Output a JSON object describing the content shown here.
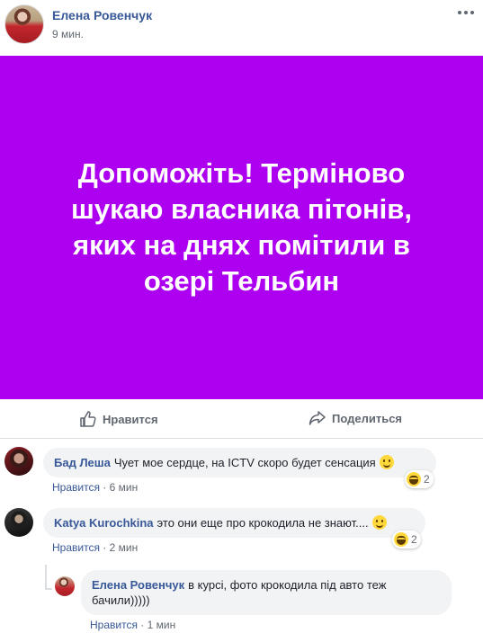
{
  "post": {
    "author": "Елена Ровенчук",
    "time": "9 мин.",
    "text": "Допоможіть! Терміново шукаю власника пітонів, яких на днях помітили в озері Тельбин",
    "background_color": "#ad00f1"
  },
  "actions": {
    "like_label": "Нравится",
    "share_label": "Поделиться"
  },
  "comments": [
    {
      "author": "Бад Леша",
      "text": "Чует мое сердце, на ICTV скоро будет сенсация",
      "emoji": "slightly-smiling-face",
      "reaction": "haha",
      "reaction_count": "2",
      "like_label": "Нравится",
      "time": "6 мин"
    },
    {
      "author": "Katya Kurochkina",
      "text": "это они еще про крокодила не знают....",
      "emoji": "laughing-face",
      "reaction": "haha",
      "reaction_count": "2",
      "like_label": "Нравится",
      "time": "2 мин"
    },
    {
      "author": "Елена Ровенчук",
      "text": "в курсі, фото крокодила під авто теж бачили)))))",
      "like_label": "Нравится",
      "time": "1 мин"
    }
  ],
  "separator": "·",
  "colors": {
    "link_blue": "#385898",
    "meta_gray": "#616770",
    "bubble_bg": "#f2f3f5"
  }
}
